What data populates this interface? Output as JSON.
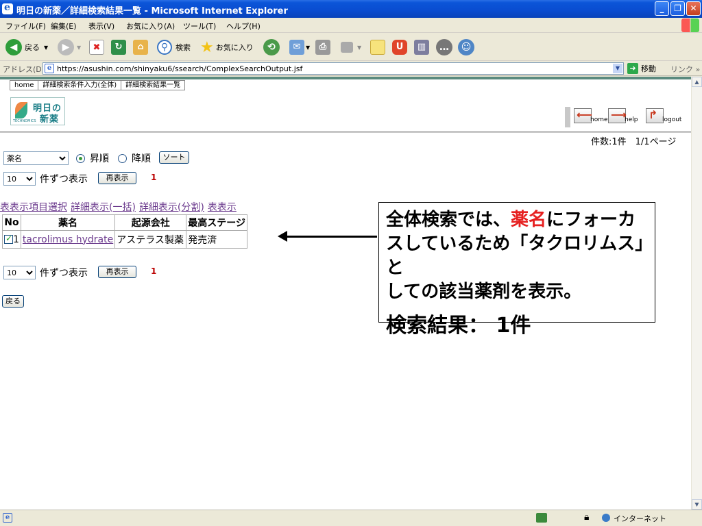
{
  "window": {
    "title": "明日の新薬／詳細検索結果一覧 - Microsoft Internet Explorer",
    "minimize_glyph": "_",
    "maximize_glyph": "❐",
    "close_glyph": "✕"
  },
  "menubar": {
    "items": [
      "ファイル(F)",
      "編集(E)",
      "表示(V)",
      "お気に入り(A)",
      "ツール(T)",
      "ヘルプ(H)"
    ]
  },
  "toolbar": {
    "back_label": "戻る",
    "search_label": "検索",
    "favorites_label": "お気に入り",
    "icons": [
      "back-icon",
      "forward-icon",
      "stop-icon",
      "refresh-icon",
      "home-icon",
      "search-icon",
      "favorites-icon",
      "history-icon",
      "mail-icon",
      "print-icon",
      "edit-icon",
      "notes-icon",
      "messenger-icon",
      "research-icon",
      "discuss-icon",
      "contacts-icon"
    ]
  },
  "address": {
    "label": "アドレス(D)",
    "url": "https://asushin.com/shinyaku6/ssearch/ComplexSearchOutput.jsf",
    "go_label": "移動",
    "links_label": "リンク"
  },
  "app": {
    "breadcrumb": [
      "home",
      "詳細検索条件入力(全体)",
      "詳細検索結果一覧"
    ],
    "logo_line1": "明日の",
    "logo_line2": "新薬",
    "logo_sub": "TECHNOMICS",
    "nav": {
      "home": "home",
      "help": "help",
      "logout": "logout"
    },
    "count_info": "件数:1件　1/1ページ"
  },
  "controls": {
    "sort_field_value": "薬名",
    "sort_asc_label": "昇順",
    "sort_desc_label": "降順",
    "sort_asc_selected": true,
    "sort_button": "ソート",
    "page_size_value": "10",
    "page_size_suffix": "件ずつ表示",
    "redisplay_button": "再表示",
    "page_number": "1"
  },
  "links": [
    "表表示項目選択",
    "詳細表示(一括)",
    "詳細表示(分割)",
    "表表示"
  ],
  "table": {
    "headers": [
      "No",
      "薬名",
      "起源会社",
      "最高ステージ"
    ],
    "rows": [
      {
        "no": "1",
        "checked": true,
        "drug": "tacrolimus hydrate",
        "company": "アステラス製薬",
        "stage": "発売済"
      }
    ]
  },
  "bottom_controls": {
    "page_size_value": "10",
    "page_size_suffix": "件ずつ表示",
    "redisplay_button": "再表示",
    "page_number": "1",
    "back_button": "戻る"
  },
  "callout": {
    "line1_prefix": "全体検索では、",
    "line1_red": "薬名",
    "line1_suffix": "にフォーカ",
    "line2": "スしているため「タクロリムス」と",
    "line3": "しての該当薬剤を表示。",
    "result": "検索結果：  1件",
    "accent_color": "#e62020"
  },
  "status": {
    "zone": "インターネット"
  }
}
